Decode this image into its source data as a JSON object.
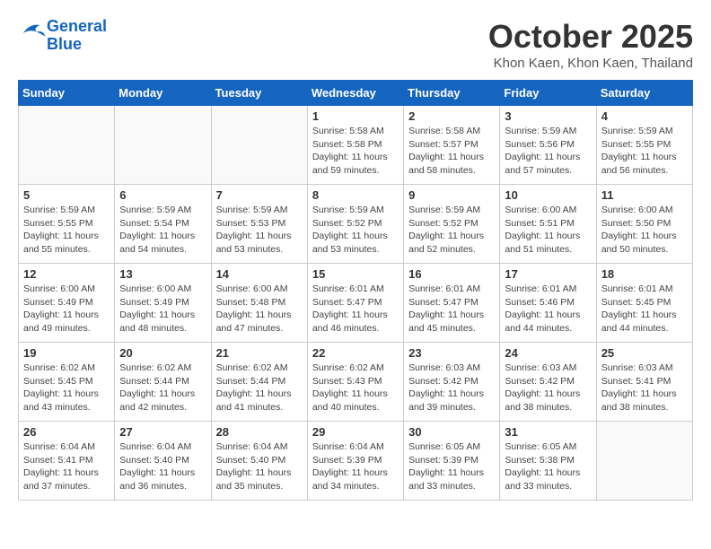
{
  "header": {
    "logo_line1": "General",
    "logo_line2": "Blue",
    "month_title": "October 2025",
    "location": "Khon Kaen, Khon Kaen, Thailand"
  },
  "weekdays": [
    "Sunday",
    "Monday",
    "Tuesday",
    "Wednesday",
    "Thursday",
    "Friday",
    "Saturday"
  ],
  "weeks": [
    [
      {
        "day": "",
        "info": ""
      },
      {
        "day": "",
        "info": ""
      },
      {
        "day": "",
        "info": ""
      },
      {
        "day": "1",
        "info": "Sunrise: 5:58 AM\nSunset: 5:58 PM\nDaylight: 11 hours\nand 59 minutes."
      },
      {
        "day": "2",
        "info": "Sunrise: 5:58 AM\nSunset: 5:57 PM\nDaylight: 11 hours\nand 58 minutes."
      },
      {
        "day": "3",
        "info": "Sunrise: 5:59 AM\nSunset: 5:56 PM\nDaylight: 11 hours\nand 57 minutes."
      },
      {
        "day": "4",
        "info": "Sunrise: 5:59 AM\nSunset: 5:55 PM\nDaylight: 11 hours\nand 56 minutes."
      }
    ],
    [
      {
        "day": "5",
        "info": "Sunrise: 5:59 AM\nSunset: 5:55 PM\nDaylight: 11 hours\nand 55 minutes."
      },
      {
        "day": "6",
        "info": "Sunrise: 5:59 AM\nSunset: 5:54 PM\nDaylight: 11 hours\nand 54 minutes."
      },
      {
        "day": "7",
        "info": "Sunrise: 5:59 AM\nSunset: 5:53 PM\nDaylight: 11 hours\nand 53 minutes."
      },
      {
        "day": "8",
        "info": "Sunrise: 5:59 AM\nSunset: 5:52 PM\nDaylight: 11 hours\nand 53 minutes."
      },
      {
        "day": "9",
        "info": "Sunrise: 5:59 AM\nSunset: 5:52 PM\nDaylight: 11 hours\nand 52 minutes."
      },
      {
        "day": "10",
        "info": "Sunrise: 6:00 AM\nSunset: 5:51 PM\nDaylight: 11 hours\nand 51 minutes."
      },
      {
        "day": "11",
        "info": "Sunrise: 6:00 AM\nSunset: 5:50 PM\nDaylight: 11 hours\nand 50 minutes."
      }
    ],
    [
      {
        "day": "12",
        "info": "Sunrise: 6:00 AM\nSunset: 5:49 PM\nDaylight: 11 hours\nand 49 minutes."
      },
      {
        "day": "13",
        "info": "Sunrise: 6:00 AM\nSunset: 5:49 PM\nDaylight: 11 hours\nand 48 minutes."
      },
      {
        "day": "14",
        "info": "Sunrise: 6:00 AM\nSunset: 5:48 PM\nDaylight: 11 hours\nand 47 minutes."
      },
      {
        "day": "15",
        "info": "Sunrise: 6:01 AM\nSunset: 5:47 PM\nDaylight: 11 hours\nand 46 minutes."
      },
      {
        "day": "16",
        "info": "Sunrise: 6:01 AM\nSunset: 5:47 PM\nDaylight: 11 hours\nand 45 minutes."
      },
      {
        "day": "17",
        "info": "Sunrise: 6:01 AM\nSunset: 5:46 PM\nDaylight: 11 hours\nand 44 minutes."
      },
      {
        "day": "18",
        "info": "Sunrise: 6:01 AM\nSunset: 5:45 PM\nDaylight: 11 hours\nand 44 minutes."
      }
    ],
    [
      {
        "day": "19",
        "info": "Sunrise: 6:02 AM\nSunset: 5:45 PM\nDaylight: 11 hours\nand 43 minutes."
      },
      {
        "day": "20",
        "info": "Sunrise: 6:02 AM\nSunset: 5:44 PM\nDaylight: 11 hours\nand 42 minutes."
      },
      {
        "day": "21",
        "info": "Sunrise: 6:02 AM\nSunset: 5:44 PM\nDaylight: 11 hours\nand 41 minutes."
      },
      {
        "day": "22",
        "info": "Sunrise: 6:02 AM\nSunset: 5:43 PM\nDaylight: 11 hours\nand 40 minutes."
      },
      {
        "day": "23",
        "info": "Sunrise: 6:03 AM\nSunset: 5:42 PM\nDaylight: 11 hours\nand 39 minutes."
      },
      {
        "day": "24",
        "info": "Sunrise: 6:03 AM\nSunset: 5:42 PM\nDaylight: 11 hours\nand 38 minutes."
      },
      {
        "day": "25",
        "info": "Sunrise: 6:03 AM\nSunset: 5:41 PM\nDaylight: 11 hours\nand 38 minutes."
      }
    ],
    [
      {
        "day": "26",
        "info": "Sunrise: 6:04 AM\nSunset: 5:41 PM\nDaylight: 11 hours\nand 37 minutes."
      },
      {
        "day": "27",
        "info": "Sunrise: 6:04 AM\nSunset: 5:40 PM\nDaylight: 11 hours\nand 36 minutes."
      },
      {
        "day": "28",
        "info": "Sunrise: 6:04 AM\nSunset: 5:40 PM\nDaylight: 11 hours\nand 35 minutes."
      },
      {
        "day": "29",
        "info": "Sunrise: 6:04 AM\nSunset: 5:39 PM\nDaylight: 11 hours\nand 34 minutes."
      },
      {
        "day": "30",
        "info": "Sunrise: 6:05 AM\nSunset: 5:39 PM\nDaylight: 11 hours\nand 33 minutes."
      },
      {
        "day": "31",
        "info": "Sunrise: 6:05 AM\nSunset: 5:38 PM\nDaylight: 11 hours\nand 33 minutes."
      },
      {
        "day": "",
        "info": ""
      }
    ]
  ]
}
